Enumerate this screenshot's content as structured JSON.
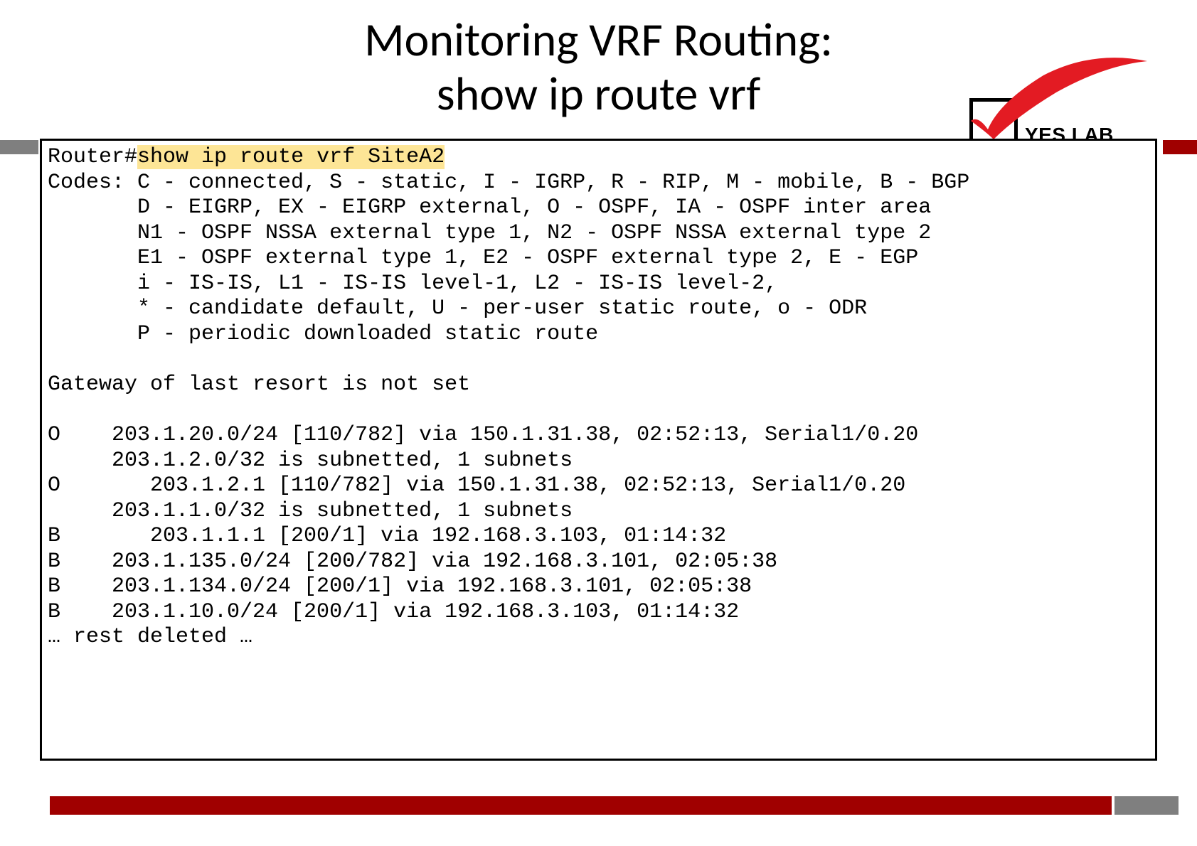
{
  "title_line1": "Monitoring VRF Routing:",
  "title_line2": "show ip route vrf",
  "logo_text": "YES LAB",
  "terminal": {
    "prompt": "Router#",
    "command": "show ip route vrf SiteA2",
    "codes_label": "Codes: ",
    "codes_lines": [
      "C - connected, S - static, I - IGRP, R - RIP, M - mobile, B - BGP",
      "D - EIGRP, EX - EIGRP external, O - OSPF, IA - OSPF inter area",
      "N1 - OSPF NSSA external type 1, N2 - OSPF NSSA external type 2",
      "E1 - OSPF external type 1, E2 - OSPF external type 2, E - EGP",
      "i - IS-IS, L1 - IS-IS level-1, L2 - IS-IS level-2,",
      "* - candidate default, U - per-user static route, o - ODR",
      "P - periodic downloaded static route"
    ],
    "gateway_line": "Gateway of last resort is not set",
    "routes": [
      "O    203.1.20.0/24 [110/782] via 150.1.31.38, 02:52:13, Serial1/0.20",
      "     203.1.2.0/32 is subnetted, 1 subnets",
      "O       203.1.2.1 [110/782] via 150.1.31.38, 02:52:13, Serial1/0.20",
      "     203.1.1.0/32 is subnetted, 1 subnets",
      "B       203.1.1.1 [200/1] via 192.168.3.103, 01:14:32",
      "B    203.1.135.0/24 [200/782] via 192.168.3.101, 02:05:38",
      "B    203.1.134.0/24 [200/1] via 192.168.3.101, 02:05:38",
      "B    203.1.10.0/24 [200/1] via 192.168.3.103, 01:14:32"
    ],
    "truncated": "… rest deleted …"
  }
}
